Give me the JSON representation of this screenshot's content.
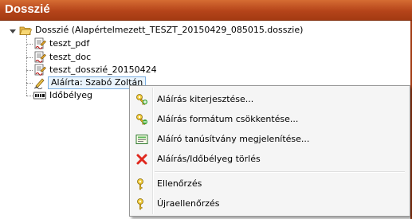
{
  "window": {
    "title": "Dosszié"
  },
  "tree": {
    "root": {
      "label": "Dosszié (Alapértelmezett_TESZT_20150429_085015.dosszie)",
      "icon": "folder-open-icon"
    },
    "children": [
      {
        "label": "teszt_pdf",
        "icon": "document-signed-icon"
      },
      {
        "label": "teszt_doc",
        "icon": "document-signed-icon"
      },
      {
        "label": "teszt_dosszié_20150424",
        "icon": "document-signed-icon"
      },
      {
        "label": "Aláírta: Szabó Zoltán",
        "icon": "signature-pen-icon",
        "selected": true
      },
      {
        "label": "Időbélyeg",
        "icon": "timestamp-icon"
      }
    ]
  },
  "context_menu": {
    "items": [
      {
        "label": "Aláírás kiterjesztése...",
        "icon": "key-add-icon"
      },
      {
        "label": "Aláírás formátum csökkentése...",
        "icon": "key-remove-icon"
      },
      {
        "label": "Aláíró tanúsítvány megjelenítése...",
        "icon": "certificate-icon"
      },
      {
        "label": "Aláírás/Időbélyeg törlés",
        "icon": "delete-x-icon"
      },
      {
        "label": "Ellenőrzés",
        "icon": "key-check-icon"
      },
      {
        "label": "Újraellenőrzés",
        "icon": "key-recheck-icon"
      }
    ]
  },
  "colors": {
    "titlebar": "#b5441a",
    "selection_border": "#7aaee0",
    "delete_red": "#e0281e"
  }
}
